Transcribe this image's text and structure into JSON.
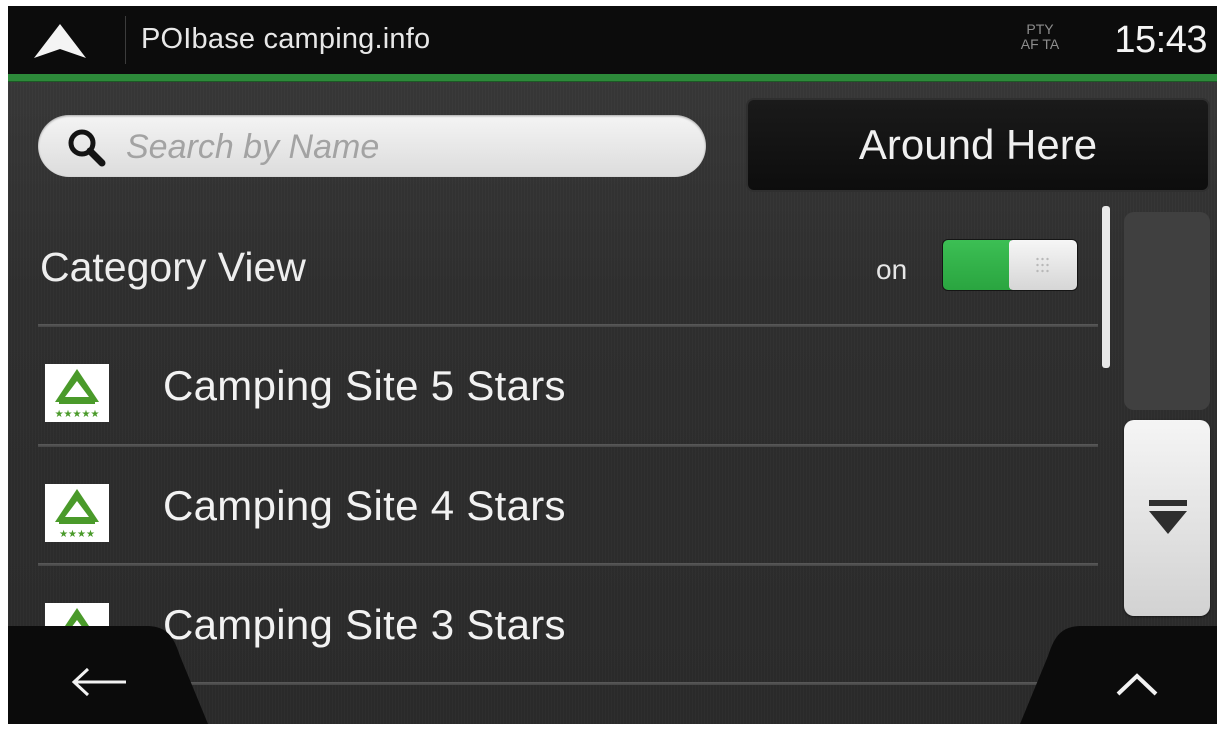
{
  "header": {
    "title": "POIbase camping.info",
    "traffic_line1": "PTY",
    "traffic_line2": "AF TA",
    "clock": "15:43"
  },
  "search": {
    "placeholder": "Search by Name",
    "around_label": "Around Here"
  },
  "category_view": {
    "label": "Category View",
    "state_label": "on",
    "enabled": true
  },
  "list": {
    "items": [
      {
        "label": "Camping Site 5 Stars",
        "stars": "★★★★★",
        "icon": "camping-5-stars-icon"
      },
      {
        "label": "Camping Site 4 Stars",
        "stars": "★★★★",
        "icon": "camping-4-stars-icon"
      },
      {
        "label": "Camping Site 3 Stars",
        "stars": "★★★",
        "icon": "camping-3-stars-icon"
      }
    ]
  },
  "colors": {
    "accent_green": "#2d8a3a",
    "toggle_green": "#3cbf54",
    "icon_green": "#4a9a2a"
  }
}
